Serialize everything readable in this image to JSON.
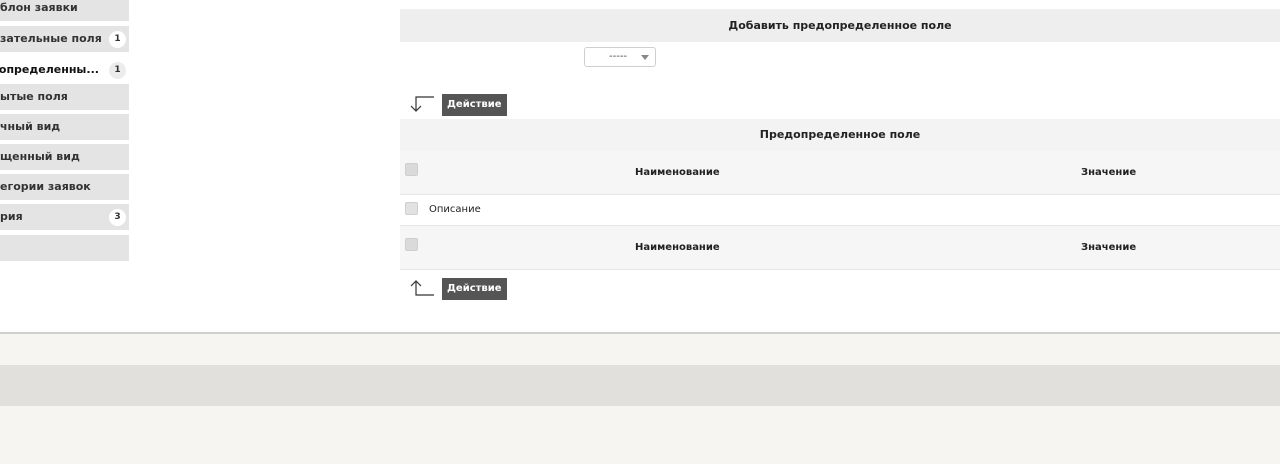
{
  "sidebar": {
    "items": [
      {
        "label": "блон заявки",
        "badge": null,
        "active": false
      },
      {
        "label": "зательные поля",
        "badge": "1",
        "active": false
      },
      {
        "label": "допределенны...",
        "badge": "1",
        "active": true
      },
      {
        "label": "ытые поля",
        "badge": null,
        "active": false
      },
      {
        "label": "чный вид",
        "badge": null,
        "active": false
      },
      {
        "label": "щенный вид",
        "badge": null,
        "active": false
      },
      {
        "label": "егории заявок",
        "badge": null,
        "active": false
      },
      {
        "label": "рия",
        "badge": "3",
        "active": false
      },
      {
        "label": "",
        "badge": null,
        "active": false
      }
    ]
  },
  "add_field": {
    "title": "Добавить предопределенное поле",
    "select_value": "-----"
  },
  "action_label": "Действие",
  "table": {
    "title": "Предопределенное поле",
    "col_name": "Наименование",
    "col_value": "Значение",
    "rows": [
      {
        "name": "Описание",
        "value": ""
      }
    ]
  }
}
